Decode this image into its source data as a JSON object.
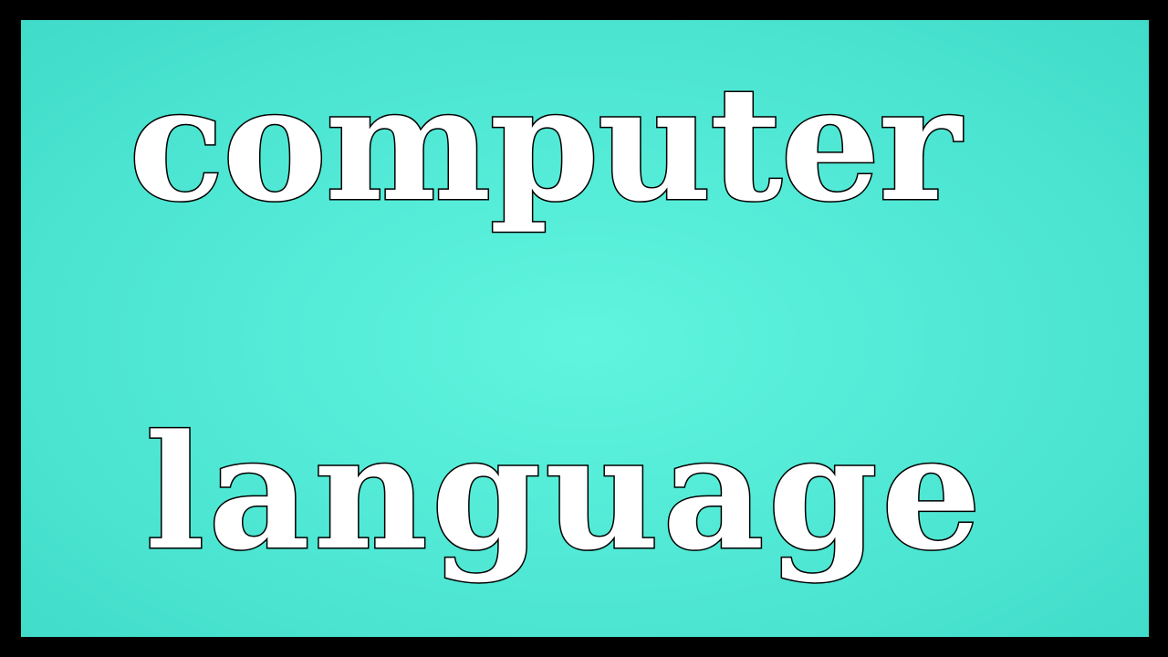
{
  "colors": {
    "border": "#000000",
    "background_center": "#5ff5de",
    "background_edge": "#40dcc9",
    "text_fill": "#ffffff",
    "text_outline": "#000000"
  },
  "title": {
    "line1": "computer",
    "line2": "language"
  }
}
